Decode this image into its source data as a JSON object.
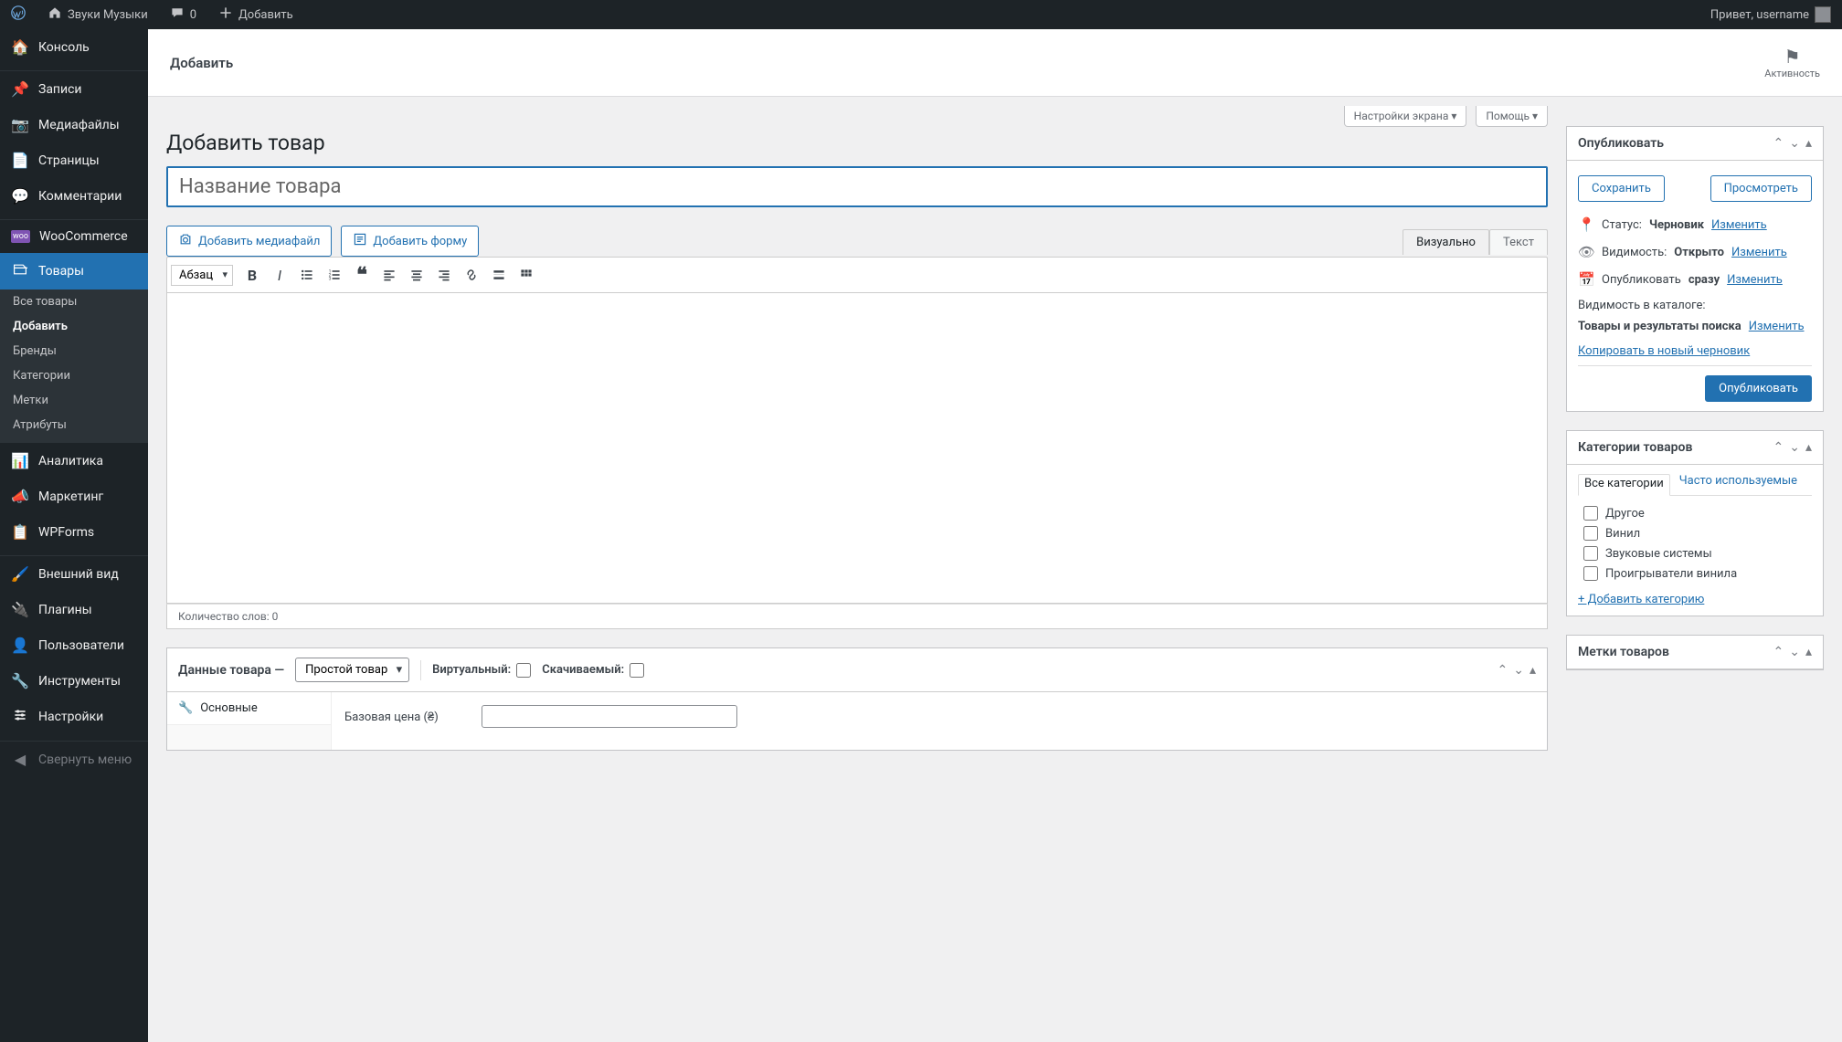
{
  "adminbar": {
    "site_name": "Звуки Музыки",
    "comments": "0",
    "add_new": "Добавить",
    "greeting": "Привет, username"
  },
  "sidebar": {
    "console": "Консоль",
    "posts": "Записи",
    "media": "Медиафайлы",
    "pages": "Страницы",
    "comments": "Комментарии",
    "woocommerce": "WooCommerce",
    "products": "Товары",
    "sub_all": "Все товары",
    "sub_add": "Добавить",
    "sub_brands": "Бренды",
    "sub_categories": "Категории",
    "sub_tags": "Метки",
    "sub_attributes": "Атрибуты",
    "analytics": "Аналитика",
    "marketing": "Маркетинг",
    "wpforms": "WPForms",
    "appearance": "Внешний вид",
    "plugins": "Плагины",
    "users": "Пользователи",
    "tools": "Инструменты",
    "settings": "Настройки",
    "collapse": "Свернуть меню"
  },
  "header": {
    "title": "Добавить",
    "activity": "Активность"
  },
  "screen_options": "Настройки экрана",
  "help": "Помощь",
  "page_title": "Добавить товар",
  "title_placeholder": "Название товара",
  "add_media": "Добавить медиафайл",
  "add_form": "Добавить форму",
  "editor": {
    "tab_visual": "Визуально",
    "tab_text": "Текст",
    "format": "Абзац",
    "word_count": "Количество слов: 0"
  },
  "product_data": {
    "title": "Данные товара —",
    "type_simple": "Простой товар",
    "virtual": "Виртуальный:",
    "downloadable": "Скачиваемый:",
    "tab_basic": "Основные",
    "base_price": "Базовая цена (₴)"
  },
  "publish": {
    "title": "Опубликовать",
    "save_draft": "Сохранить",
    "preview": "Просмотреть",
    "status_label": "Статус:",
    "status_value": "Черновик",
    "visibility_label": "Видимость:",
    "visibility_value": "Открыто",
    "publish_label": "Опубликовать",
    "publish_value": "сразу",
    "catalog_label": "Видимость в каталоге:",
    "catalog_value": "Товары и результаты поиска",
    "edit": "Изменить",
    "copy_draft": "Копировать в новый черновик",
    "publish_btn": "Опубликовать"
  },
  "categories": {
    "title": "Категории товаров",
    "tab_all": "Все категории",
    "tab_frequent": "Часто используемые",
    "items": [
      "Другое",
      "Винил",
      "Звуковые системы",
      "Проигрыватели винила"
    ],
    "add_new": "+ Добавить категорию"
  },
  "tags": {
    "title": "Метки товаров"
  }
}
